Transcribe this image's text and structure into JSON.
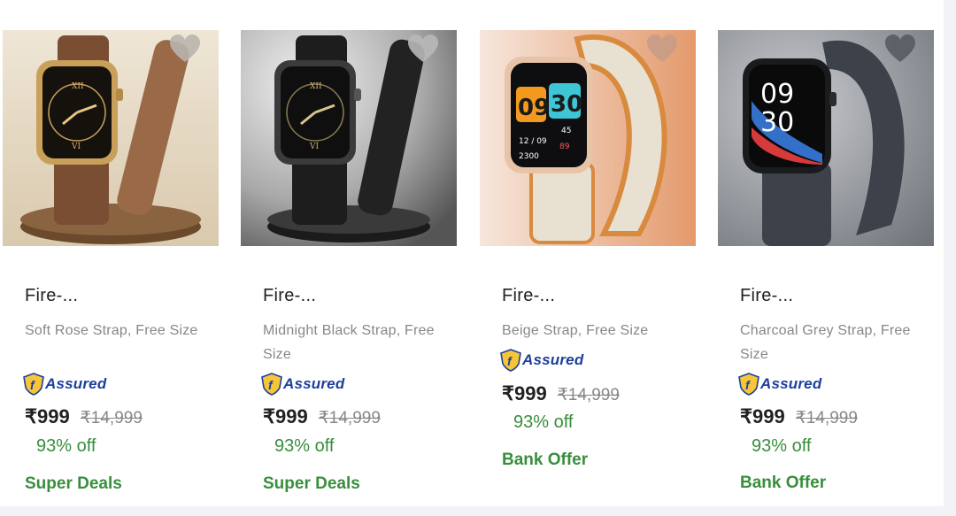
{
  "products": [
    {
      "title": "Fire-...",
      "variant": "Soft Rose Strap, Free Size",
      "assured_label": "Assured",
      "price": "₹999",
      "mrp": "₹14,999",
      "discount": "93% off",
      "offer": "Super Deals",
      "strap_color": "#8b5a3c",
      "bg_color": "#e8ddcc",
      "wishlist_icon": "heart-icon"
    },
    {
      "title": "Fire-...",
      "variant": "Midnight Black Strap, Free Size",
      "assured_label": "Assured",
      "price": "₹999",
      "mrp": "₹14,999",
      "discount": "93% off",
      "offer": "Super Deals",
      "strap_color": "#1e1e1e",
      "bg_color": "#bcbcbc",
      "wishlist_icon": "heart-icon"
    },
    {
      "title": "Fire-...",
      "variant": "Beige Strap, Free Size",
      "assured_label": "Assured",
      "price": "₹999",
      "mrp": "₹14,999",
      "discount": "93% off",
      "offer": "Bank Offer",
      "strap_color": "#e6dfcf",
      "bg_color": "#efc2a6",
      "wishlist_icon": "heart-icon"
    },
    {
      "title": "Fire-...",
      "variant": "Charcoal Grey Strap, Free Size",
      "assured_label": "Assured",
      "price": "₹999",
      "mrp": "₹14,999",
      "discount": "93% off",
      "offer": "Bank Offer",
      "strap_color": "#3b4048",
      "bg_color": "#8d9096",
      "wishlist_icon": "heart-icon"
    }
  ],
  "colors": {
    "accent_green": "#388e3c",
    "assured_blue": "#1d3f9a",
    "text_primary": "#212121",
    "text_secondary": "#878787"
  }
}
